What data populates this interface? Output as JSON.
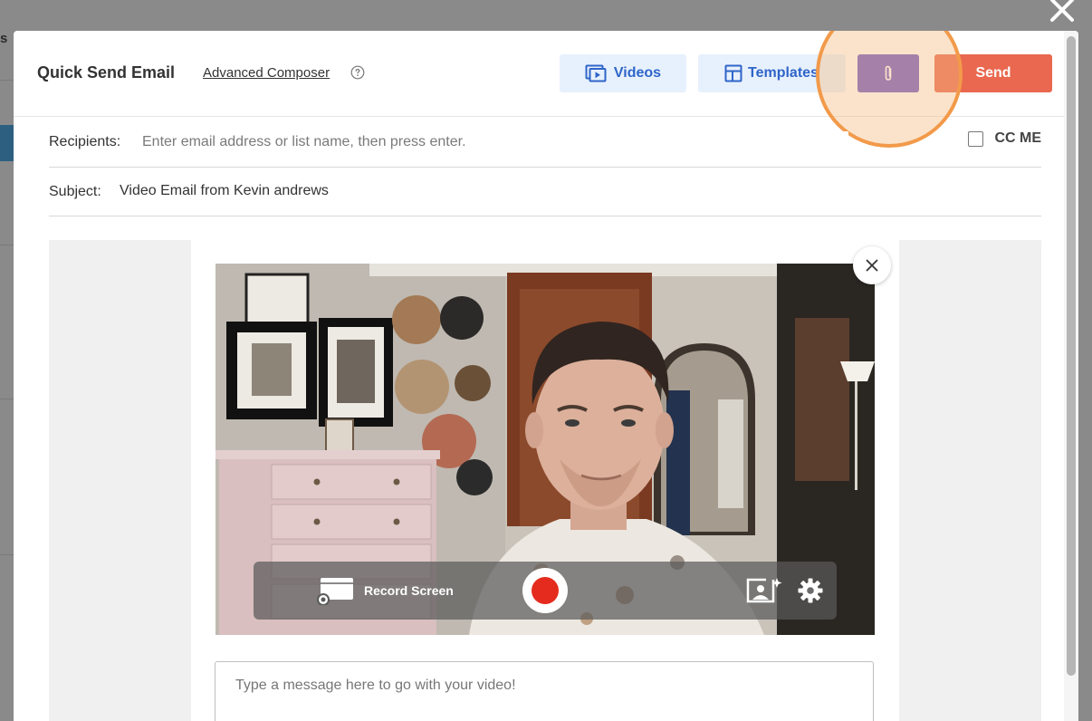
{
  "background": {
    "partial_letter": "s"
  },
  "modal": {
    "title": "Quick Send Email",
    "advanced_link": "Advanced Composer",
    "buttons": {
      "videos": "Videos",
      "templates": "Templates",
      "send": "Send"
    },
    "recipients": {
      "label": "Recipients:",
      "placeholder": "Enter email address or list name, then press enter.",
      "value": ""
    },
    "cc_me": {
      "label": "CC ME",
      "checked": false
    },
    "subject": {
      "label": "Subject:",
      "value": "Video Email from Kevin andrews"
    },
    "recorder": {
      "record_screen_label": "Record Screen"
    },
    "message": {
      "placeholder": "Type a message here to go with your video!",
      "value": ""
    }
  },
  "colors": {
    "overlay": "#8a8a8a",
    "videos_bg": "#e7f1fd",
    "videos_text": "#2f65c9",
    "attach_button": "#6b57c4",
    "send_button": "#e9684f",
    "highlight_ring": "#f29a4a",
    "record_dot": "#e42b1d"
  },
  "icons": {
    "close_modal": "close-icon",
    "help": "help-circle-icon",
    "videos": "video-library-icon",
    "templates": "template-layout-icon",
    "attach": "paperclip-icon",
    "close_video": "close-icon",
    "record_screen": "screen-record-icon",
    "virtual_background": "virtual-background-icon",
    "settings": "gear-icon"
  }
}
